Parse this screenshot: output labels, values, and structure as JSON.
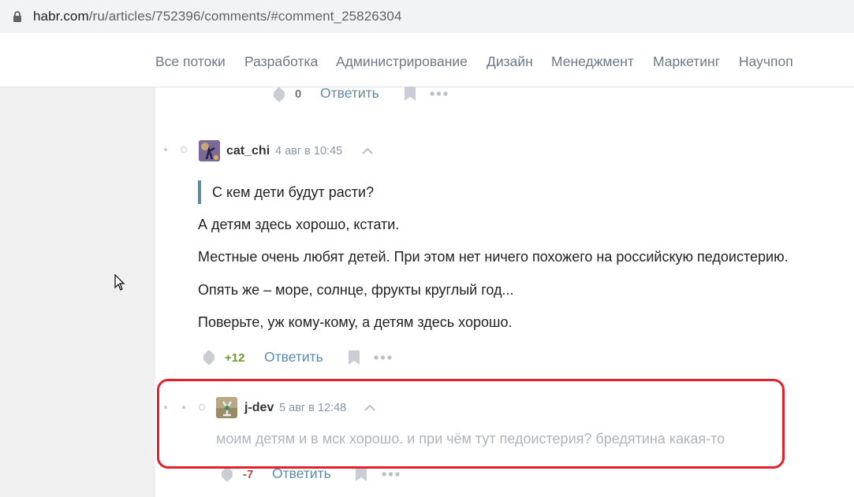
{
  "browser": {
    "url_host": "habr.com",
    "url_path": "/ru/articles/752396/comments/#comment_25826304"
  },
  "nav": {
    "items": [
      "Все потоки",
      "Разработка",
      "Администрирование",
      "Дизайн",
      "Менеджмент",
      "Маркетинг",
      "Научпоп"
    ]
  },
  "prev_comment": {
    "score": "0",
    "reply_label": "Ответить"
  },
  "comment_cat": {
    "username": "cat_chi",
    "time": "4 авг в 10:45",
    "quote": "С кем дети будут расти?",
    "paragraphs": [
      "А детям здесь хорошо, кстати.",
      "Местные очень любят детей. При этом нет ничего похожего на российскую педоистерию.",
      "Опять же – море, солнце, фрукты круглый год...",
      "Поверьте, уж кому-кому, а детям здесь хорошо."
    ],
    "score": "+12",
    "score_color": "#6c9a2a",
    "reply_label": "Ответить"
  },
  "comment_jdev": {
    "username": "j-dev",
    "time": "5 авг в 12:48",
    "text": "моим детям и в мск хорошо. и при чём тут педоистерия? бредятина какая-то",
    "score": "-7",
    "score_color": "#b0494e",
    "reply_label": "Ответить"
  },
  "colors": {
    "accent": "#5e8aa8",
    "highlight": "#e3202b"
  }
}
